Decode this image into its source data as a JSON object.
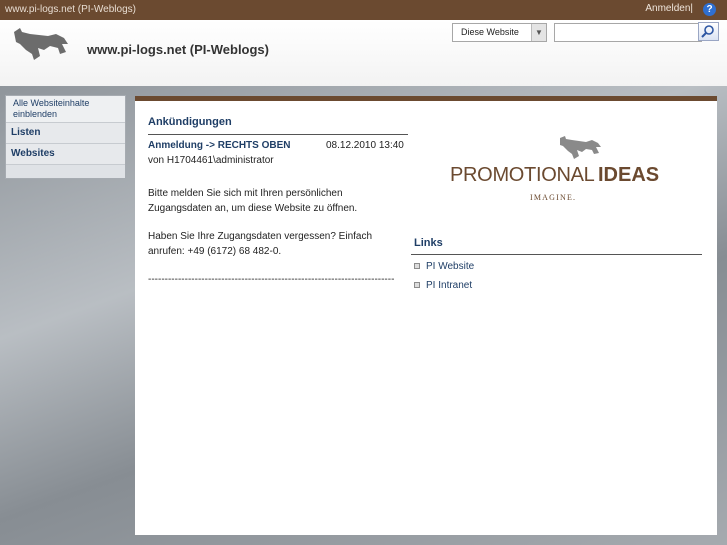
{
  "topbar": {
    "site_label": "www.pi-logs.net (PI-Weblogs)",
    "signin": "Anmelden|",
    "help_glyph": "?"
  },
  "header": {
    "title": "www.pi-logs.net (PI-Weblogs)"
  },
  "search": {
    "scope": "Diese Website",
    "value": ""
  },
  "nav": {
    "all_content": "Alle Websiteinhalte einblenden",
    "items": [
      "Listen",
      "Websites"
    ]
  },
  "announcements": {
    "title": "Ankündigungen",
    "subject": "Anmeldung -> RECHTS OBEN",
    "date": "08.12.2010 13:40",
    "author": "von H1704461\\administrator",
    "body": [
      "Bitte melden Sie sich mit Ihren persönlichen Zugangsdaten an, um diese Website zu öffnen.",
      "Haben Sie Ihre Zugangsdaten vergessen? Einfach anrufen: +49 (6172) 68 482-0.",
      "--------------------------------------------------------------------------"
    ]
  },
  "logo": {
    "word1": "PROMOTIONAL",
    "word2": "IDEAS",
    "tagline": "IMAGINE."
  },
  "links": {
    "title": "Links",
    "items": [
      "PI Website",
      "PI Intranet"
    ]
  },
  "colors": {
    "brand_brown": "#6b4a30",
    "link_blue": "#1f3e66",
    "help_blue": "#2f6fd0"
  }
}
